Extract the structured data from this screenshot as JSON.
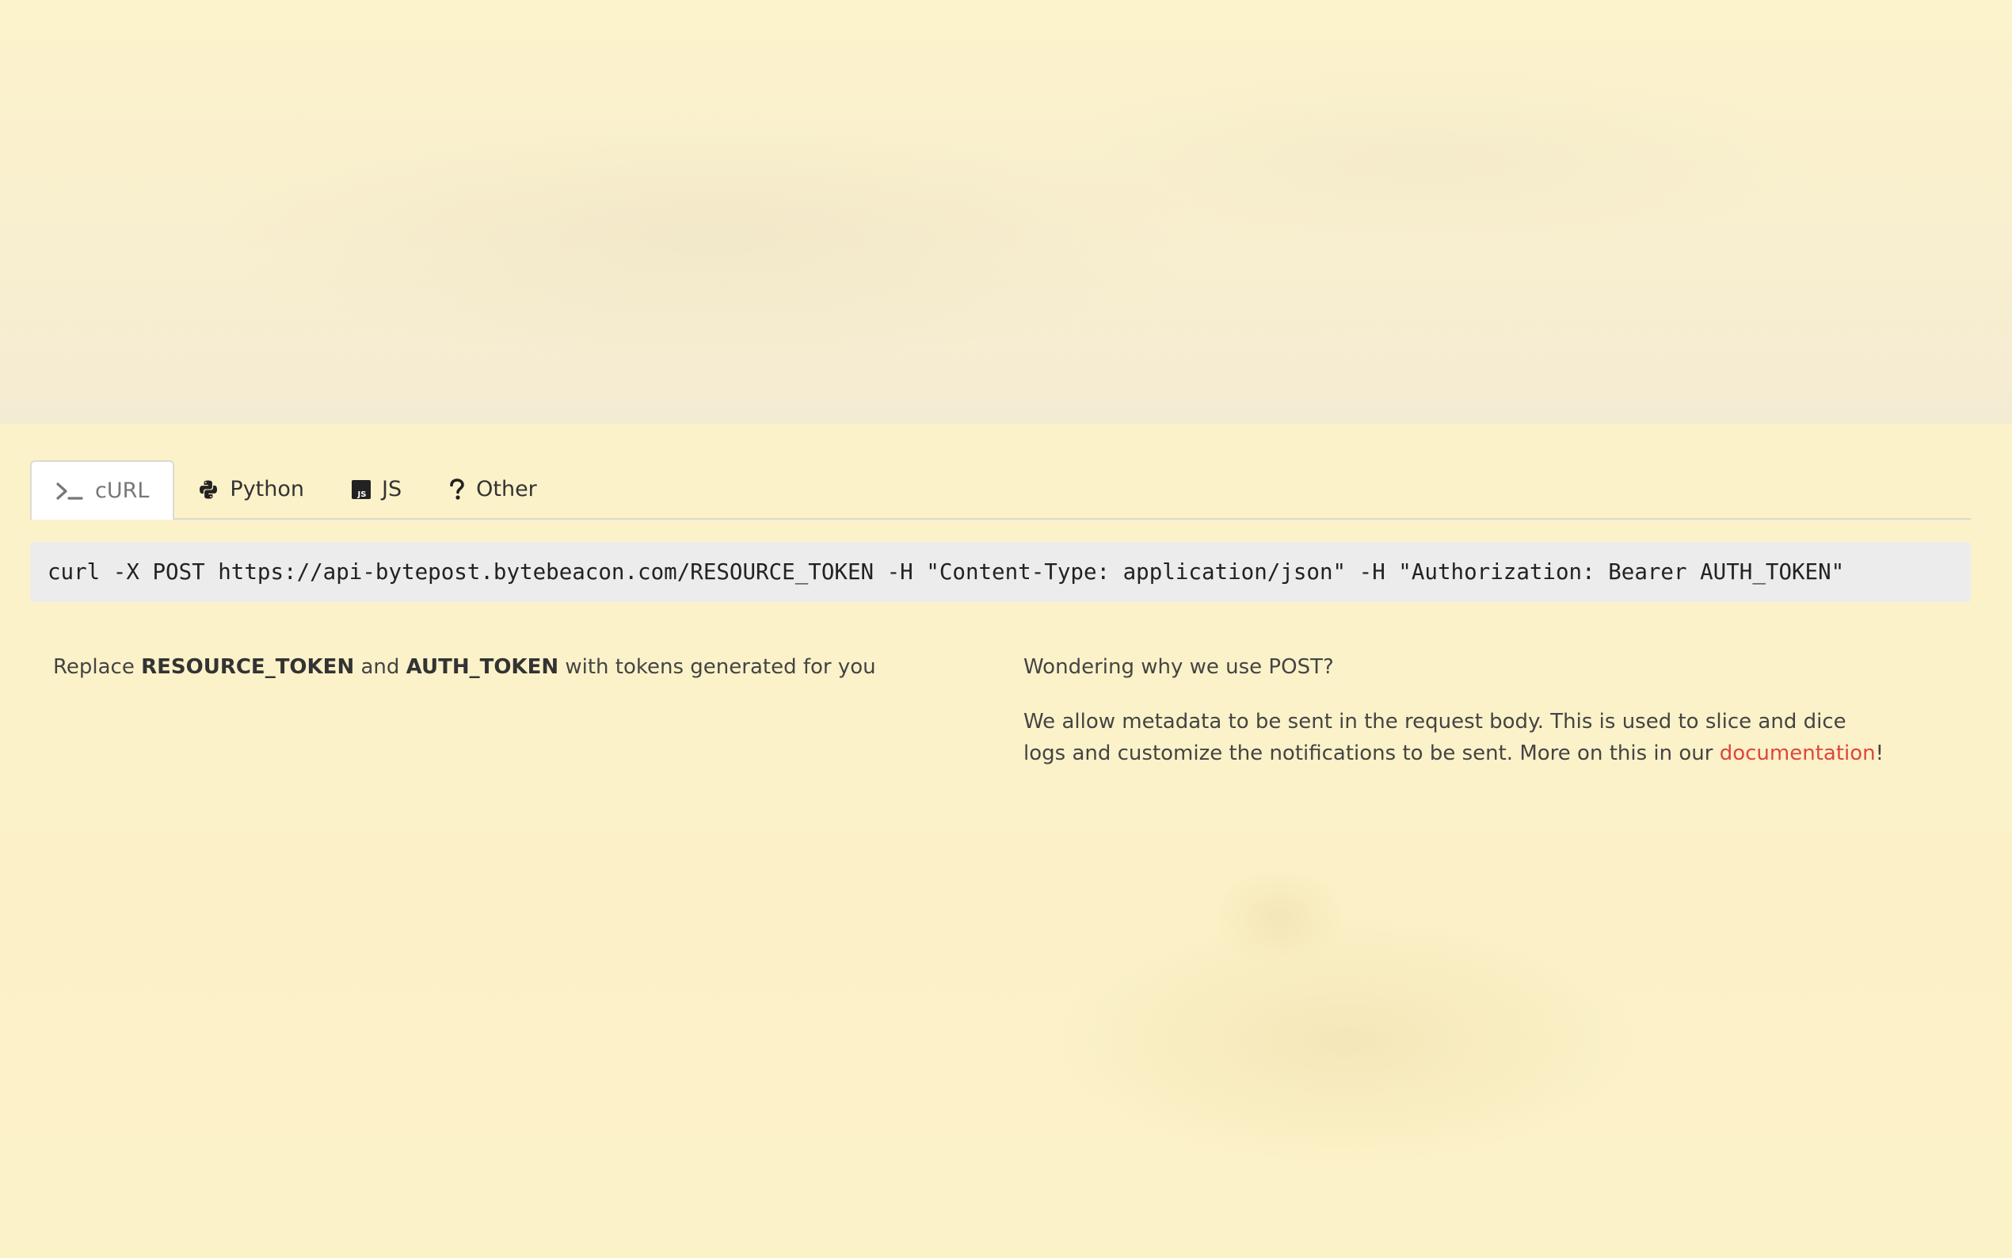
{
  "tabs": [
    {
      "label": "cURL",
      "icon": "terminal-icon",
      "active": true
    },
    {
      "label": "Python",
      "icon": "python-icon",
      "active": false
    },
    {
      "label": "JS",
      "icon": "js-icon",
      "active": false
    },
    {
      "label": "Other",
      "icon": "question-icon",
      "active": false
    }
  ],
  "code": {
    "command": "curl -X POST https://api-bytepost.bytebeacon.com/RESOURCE_TOKEN -H \"Content-Type: application/json\" -H \"Authorization: Bearer AUTH_TOKEN\""
  },
  "note": {
    "prefix": "Replace ",
    "token1": "RESOURCE_TOKEN",
    "middle": " and ",
    "token2": "AUTH_TOKEN",
    "suffix": " with tokens generated for you"
  },
  "info": {
    "heading": "Wondering why we use POST?",
    "body": "We allow metadata to be sent in the request body. This is used to slice and dice logs and customize the notifications to be sent. More on this in our ",
    "link": "documentation",
    "end": "!"
  },
  "colors": {
    "background": "#fcf2c9",
    "link": "#e0453c",
    "code_bg": "#ececec"
  }
}
